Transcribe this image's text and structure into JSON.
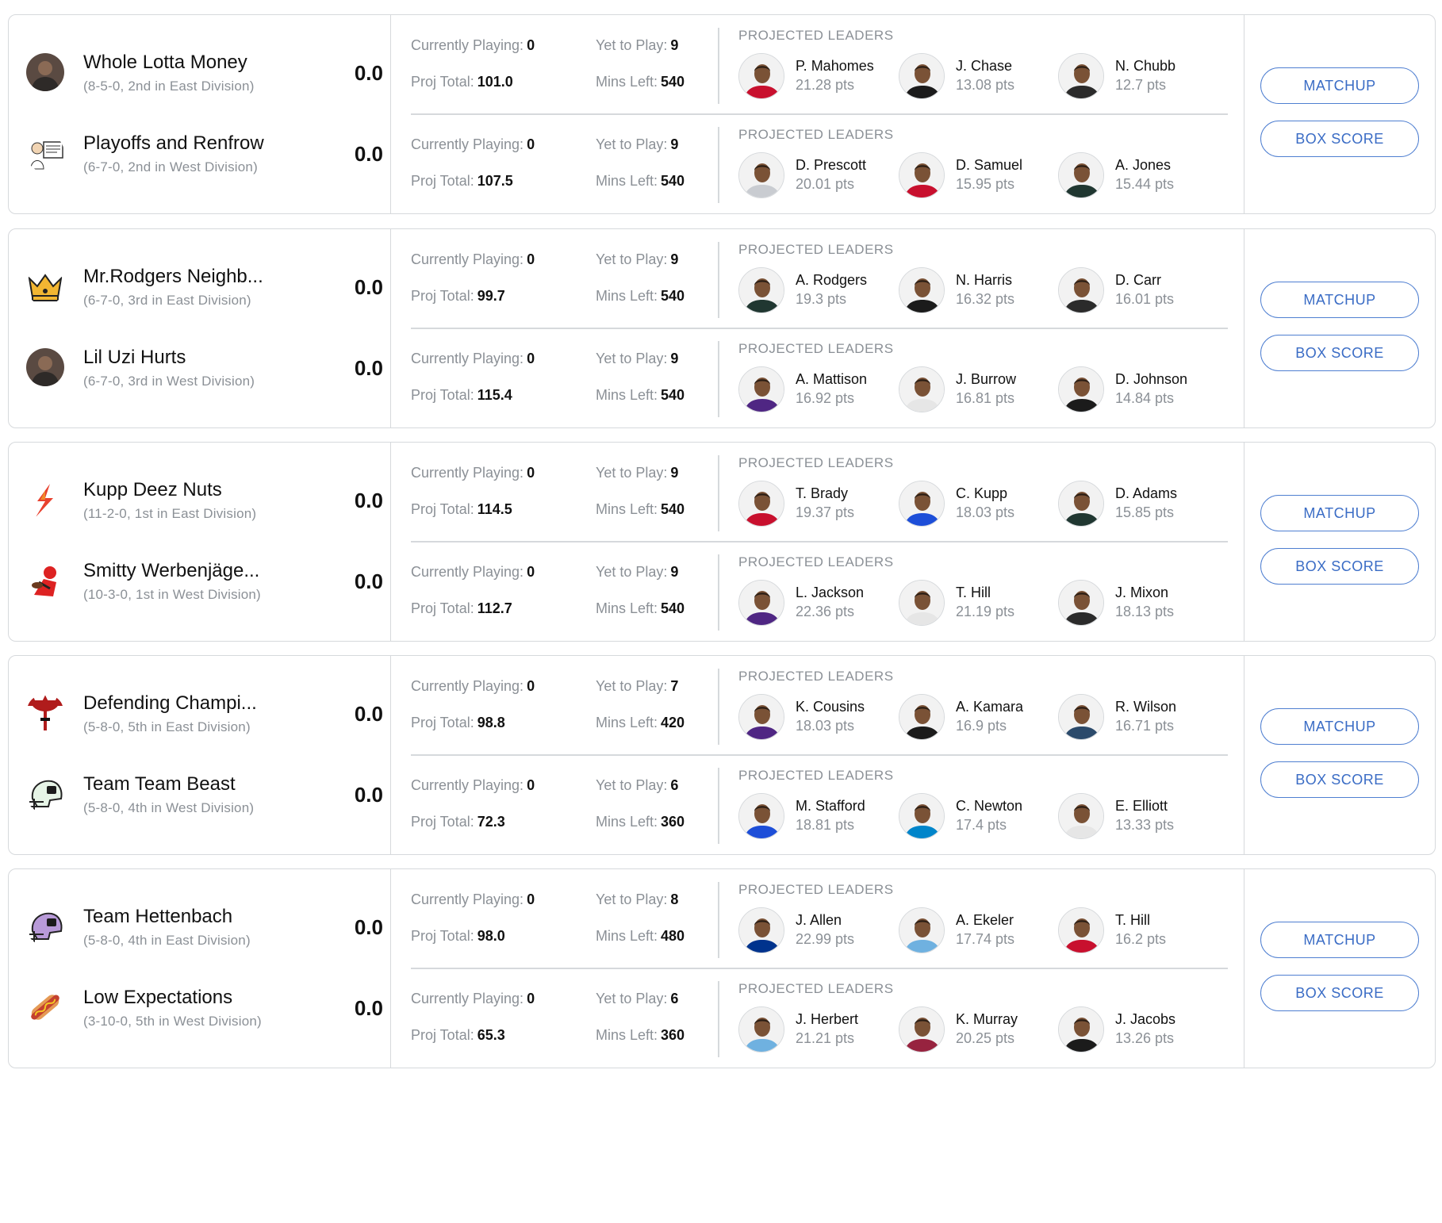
{
  "labels": {
    "currently_playing": "Currently Playing:",
    "yet_to_play": "Yet to Play:",
    "proj_total": "Proj Total:",
    "mins_left": "Mins Left:",
    "projected_leaders": "PROJECTED LEADERS",
    "matchup_button": "MATCHUP",
    "box_score_button": "BOX SCORE"
  },
  "matchups": [
    {
      "teams": [
        {
          "name": "Whole Lotta Money",
          "record": "(8-5-0, 2nd in East Division)",
          "score": "0.0",
          "logo": "photo-avatar",
          "currently_playing": "0",
          "yet_to_play": "9",
          "proj_total": "101.0",
          "mins_left": "540",
          "leaders": [
            {
              "name": "P. Mahomes",
              "pts": "21.28 pts"
            },
            {
              "name": "J. Chase",
              "pts": "13.08 pts"
            },
            {
              "name": "N. Chubb",
              "pts": "12.7 pts"
            }
          ]
        },
        {
          "name": "Playoffs and Renfrow",
          "record": "(6-7-0, 2nd in West Division)",
          "score": "0.0",
          "logo": "cartoon-sign-logo",
          "currently_playing": "0",
          "yet_to_play": "9",
          "proj_total": "107.5",
          "mins_left": "540",
          "leaders": [
            {
              "name": "D. Prescott",
              "pts": "20.01 pts"
            },
            {
              "name": "D. Samuel",
              "pts": "15.95 pts"
            },
            {
              "name": "A. Jones",
              "pts": "15.44 pts"
            }
          ]
        }
      ]
    },
    {
      "teams": [
        {
          "name": "Mr.Rodgers Neighb...",
          "record": "(6-7-0, 3rd in East Division)",
          "score": "0.0",
          "logo": "crown-logo",
          "currently_playing": "0",
          "yet_to_play": "9",
          "proj_total": "99.7",
          "mins_left": "540",
          "leaders": [
            {
              "name": "A. Rodgers",
              "pts": "19.3 pts"
            },
            {
              "name": "N. Harris",
              "pts": "16.32 pts"
            },
            {
              "name": "D. Carr",
              "pts": "16.01 pts"
            }
          ]
        },
        {
          "name": "Lil Uzi Hurts",
          "record": "(6-7-0, 3rd in West Division)",
          "score": "0.0",
          "logo": "photo-avatar",
          "currently_playing": "0",
          "yet_to_play": "9",
          "proj_total": "115.4",
          "mins_left": "540",
          "leaders": [
            {
              "name": "A. Mattison",
              "pts": "16.92 pts"
            },
            {
              "name": "J. Burrow",
              "pts": "16.81 pts"
            },
            {
              "name": "D. Johnson",
              "pts": "14.84 pts"
            }
          ]
        }
      ]
    },
    {
      "teams": [
        {
          "name": "Kupp Deez Nuts",
          "record": "(11-2-0, 1st in East Division)",
          "score": "0.0",
          "logo": "flame-logo",
          "currently_playing": "0",
          "yet_to_play": "9",
          "proj_total": "114.5",
          "mins_left": "540",
          "leaders": [
            {
              "name": "T. Brady",
              "pts": "19.37 pts"
            },
            {
              "name": "C. Kupp",
              "pts": "18.03 pts"
            },
            {
              "name": "D. Adams",
              "pts": "15.85 pts"
            }
          ]
        },
        {
          "name": "Smitty Werbenjäge...",
          "record": "(10-3-0, 1st in West Division)",
          "score": "0.0",
          "logo": "player-logo",
          "currently_playing": "0",
          "yet_to_play": "9",
          "proj_total": "112.7",
          "mins_left": "540",
          "leaders": [
            {
              "name": "L. Jackson",
              "pts": "22.36 pts"
            },
            {
              "name": "T. Hill",
              "pts": "21.19 pts"
            },
            {
              "name": "J. Mixon",
              "pts": "18.13 pts"
            }
          ]
        }
      ]
    },
    {
      "teams": [
        {
          "name": "Defending Champi...",
          "record": "(5-8-0, 5th in East Division)",
          "score": "0.0",
          "logo": "trident-logo",
          "currently_playing": "0",
          "yet_to_play": "7",
          "proj_total": "98.8",
          "mins_left": "420",
          "leaders": [
            {
              "name": "K. Cousins",
              "pts": "18.03 pts"
            },
            {
              "name": "A. Kamara",
              "pts": "16.9 pts"
            },
            {
              "name": "R. Wilson",
              "pts": "16.71 pts"
            }
          ]
        },
        {
          "name": "Team Team Beast",
          "record": "(5-8-0, 4th in West Division)",
          "score": "0.0",
          "logo": "helmet-green-logo",
          "currently_playing": "0",
          "yet_to_play": "6",
          "proj_total": "72.3",
          "mins_left": "360",
          "leaders": [
            {
              "name": "M. Stafford",
              "pts": "18.81 pts"
            },
            {
              "name": "C. Newton",
              "pts": "17.4 pts"
            },
            {
              "name": "E. Elliott",
              "pts": "13.33 pts"
            }
          ]
        }
      ]
    },
    {
      "teams": [
        {
          "name": "Team Hettenbach",
          "record": "(5-8-0, 4th in East Division)",
          "score": "0.0",
          "logo": "helmet-purple-logo",
          "currently_playing": "0",
          "yet_to_play": "8",
          "proj_total": "98.0",
          "mins_left": "480",
          "leaders": [
            {
              "name": "J. Allen",
              "pts": "22.99 pts"
            },
            {
              "name": "A. Ekeler",
              "pts": "17.74 pts"
            },
            {
              "name": "T. Hill",
              "pts": "16.2 pts"
            }
          ]
        },
        {
          "name": "Low Expectations",
          "record": "(3-10-0, 5th in West Division)",
          "score": "0.0",
          "logo": "hotdog-logo",
          "currently_playing": "0",
          "yet_to_play": "6",
          "proj_total": "65.3",
          "mins_left": "360",
          "leaders": [
            {
              "name": "J. Herbert",
              "pts": "21.21 pts"
            },
            {
              "name": "K. Murray",
              "pts": "20.25 pts"
            },
            {
              "name": "J. Jacobs",
              "pts": "13.26 pts"
            }
          ]
        }
      ]
    }
  ],
  "colors": {
    "accent": "#3a6cc5",
    "border": "#d6d9dc",
    "muted": "#8b9096",
    "jersey_colors": [
      [
        "#c8102e",
        "#1b1b1b",
        "#2b2b2b"
      ],
      [
        "#c9ccd1",
        "#c8102e",
        "#203731"
      ],
      [
        "#203731",
        "#1b1b1b",
        "#2b2b2b"
      ],
      [
        "#4f2683",
        "#e6e6e6",
        "#1b1b1b"
      ],
      [
        "#c8102e",
        "#1d4ed8",
        "#203731"
      ],
      [
        "#4f2683",
        "#e6e6e6",
        "#2b2b2b"
      ],
      [
        "#4f2683",
        "#1b1b1b",
        "#2b4a6b"
      ],
      [
        "#1d4ed8",
        "#0085ca",
        "#e6e6e6"
      ],
      [
        "#00338d",
        "#6fb1e0",
        "#c8102e"
      ],
      [
        "#6fb1e0",
        "#97233f",
        "#1b1b1b"
      ]
    ]
  }
}
